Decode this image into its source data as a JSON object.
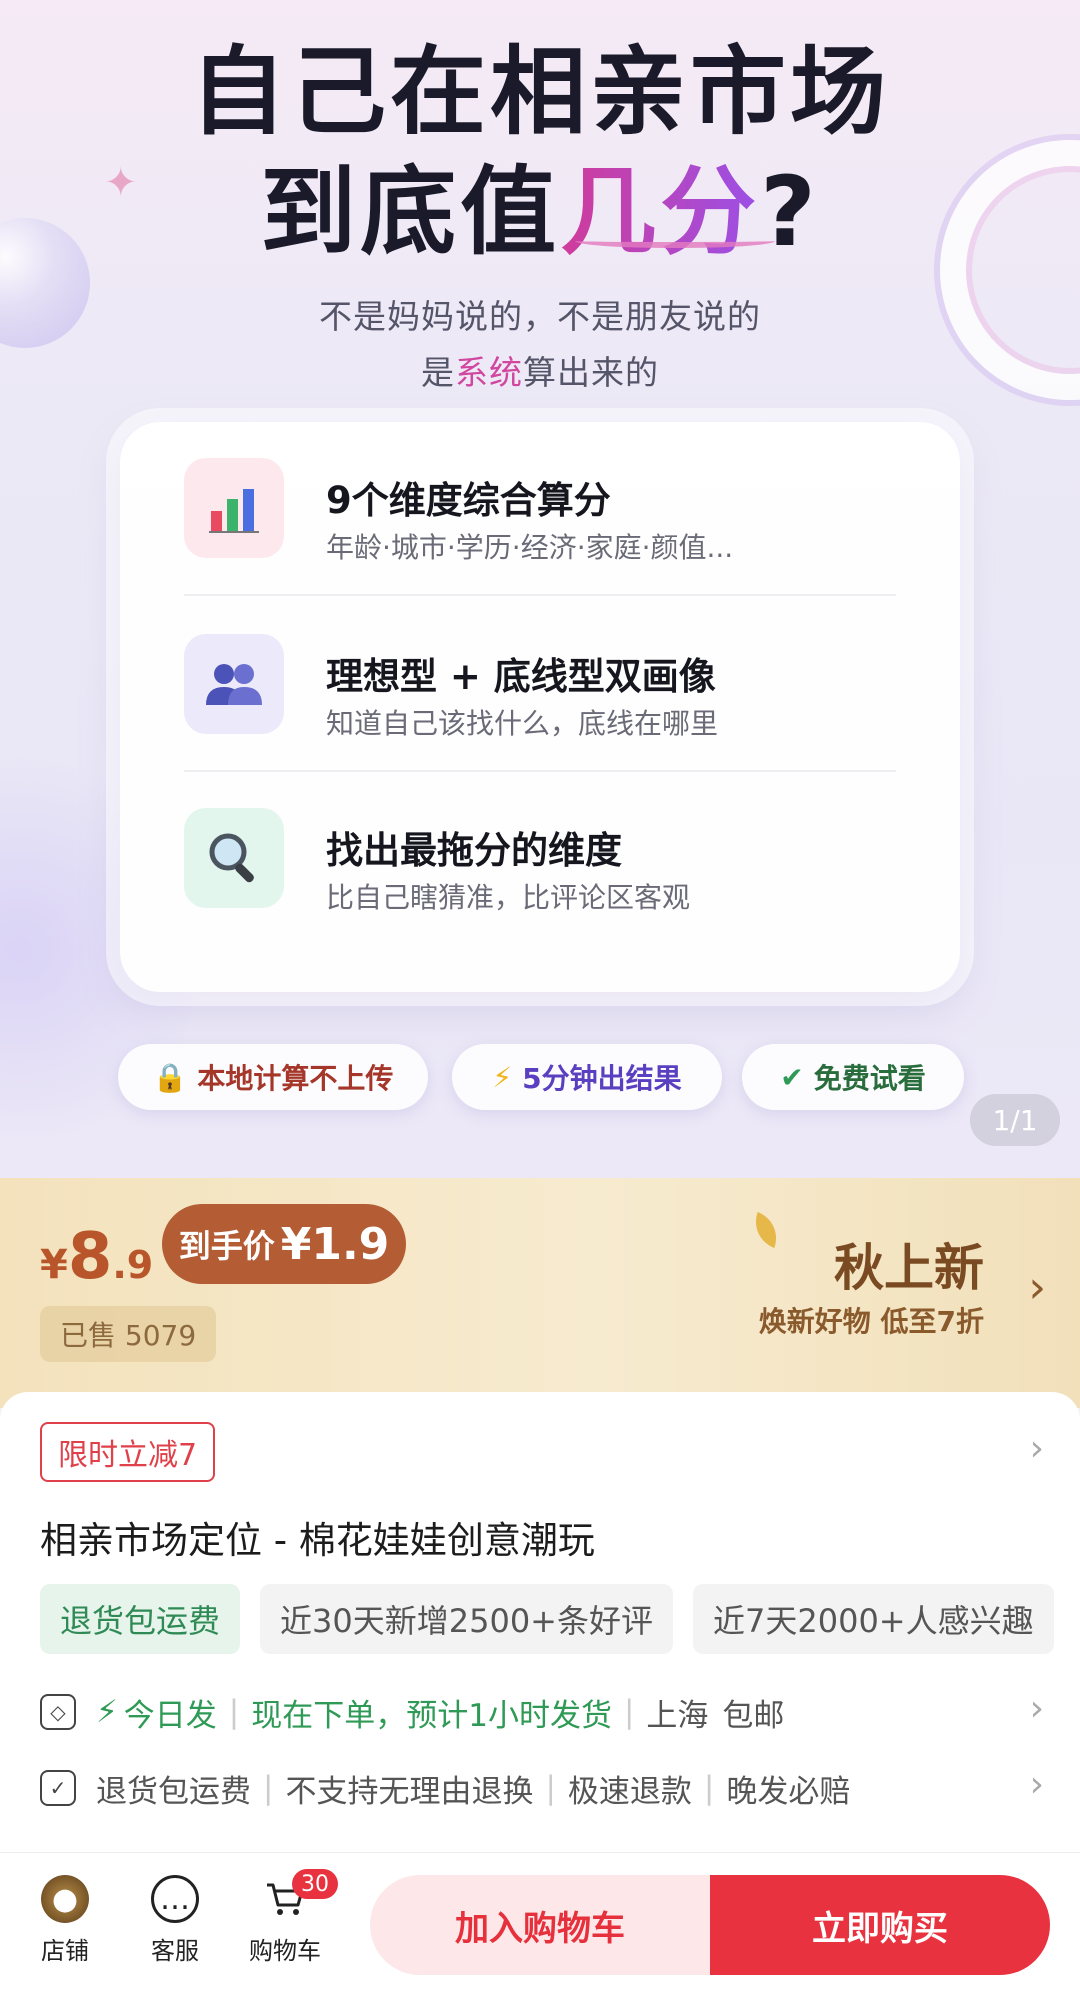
{
  "hero": {
    "headline_line1": "自己在相亲市场",
    "headline_line2_prefix": "到底值",
    "headline_line2_accent": "几分",
    "headline_line2_suffix": "?",
    "sub_line1": "不是妈妈说的，不是朋友说的",
    "sub_line2_prefix": "是",
    "sub_line2_accent": "系统",
    "sub_line2_suffix": "算出来的",
    "features": [
      {
        "icon": "bar-chart-icon",
        "title": "9个维度综合算分",
        "desc": "年龄·城市·学历·经济·家庭·颜值..."
      },
      {
        "icon": "people-icon",
        "title": "理想型 + 底线型双画像",
        "desc": "知道自己该找什么，底线在哪里"
      },
      {
        "icon": "magnifier-icon",
        "title": "找出最拖分的维度",
        "desc": "比自己瞎猜准，比评论区客观"
      }
    ],
    "pills": [
      {
        "icon": "lock-icon",
        "label": "本地计算不上传"
      },
      {
        "icon": "lightning-icon",
        "label": "5分钟出结果"
      },
      {
        "icon": "check-icon",
        "label": "免费试看"
      }
    ],
    "pager": "1/1"
  },
  "price": {
    "currency": "¥",
    "original_int": "8",
    "original_dec": ".9",
    "hand_label": "到手价",
    "hand_value": "¥1.9",
    "sold": "已售 5079",
    "promo_title": "秋上新",
    "promo_sub": "焕新好物 低至7折"
  },
  "info": {
    "limit_tag": "限时立减7",
    "product_title": "相亲市场定位 - 棉花娃娃创意潮玩",
    "tags": [
      "退货包运费",
      "近30天新增2500+条好评",
      "近7天2000+人感兴趣"
    ],
    "ship_today": "今日发",
    "ship_detail": "现在下单，预计1小时发货",
    "ship_from": "上海",
    "ship_free": "包邮",
    "service_items": [
      "退货包运费",
      "不支持无理由退换",
      "极速退款",
      "晚发必赔"
    ]
  },
  "bottom_bar": {
    "store": "店铺",
    "service": "客服",
    "cart": "购物车",
    "cart_count": "30",
    "add_to_cart": "加入购物车",
    "buy_now": "立即购买"
  },
  "colors": {
    "accent_red": "#e8323f",
    "accent_pink": "#d1479f",
    "price_brown": "#b45c33",
    "green": "#2f9a55"
  }
}
